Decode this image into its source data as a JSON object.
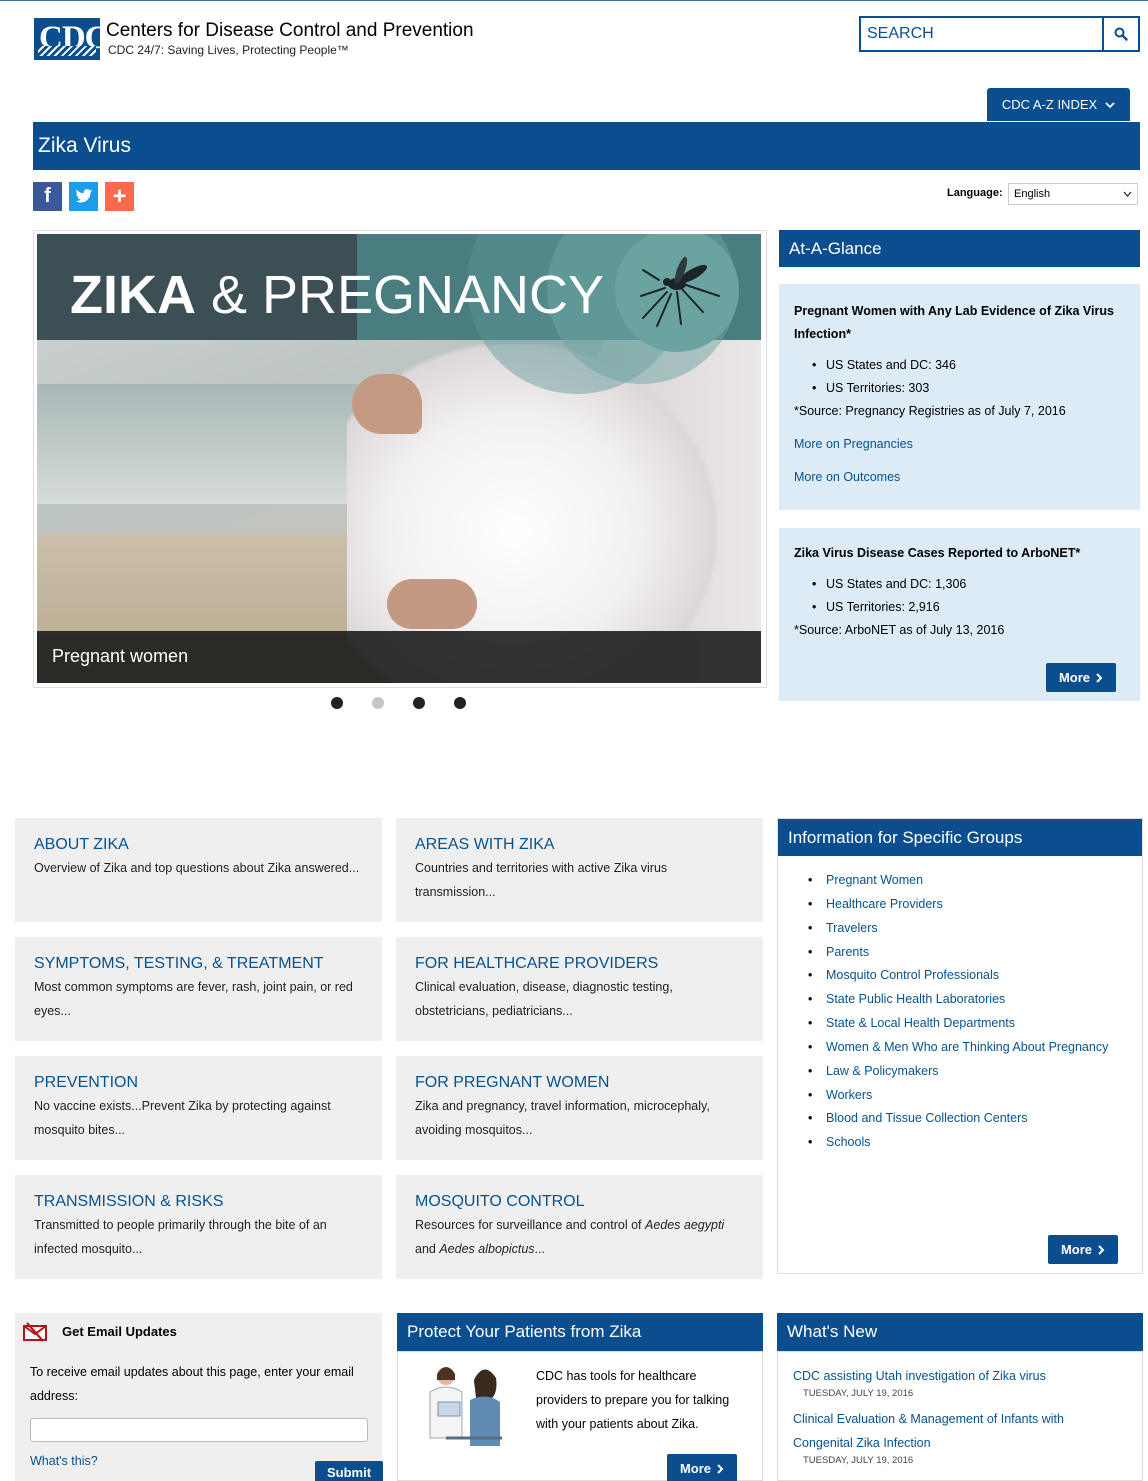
{
  "header": {
    "logo": "CDC",
    "org_title": "Centers for Disease Control and Prevention",
    "tagline": "CDC 24/7: Saving Lives, Protecting People™",
    "search_placeholder": "SEARCH",
    "az_index": "CDC A-Z INDEX"
  },
  "page": {
    "title": "Zika Virus",
    "language_label": "Language:",
    "language_value": "English"
  },
  "carousel": {
    "banner_bold": "ZIKA",
    "banner_rest": " & PREGNANCY",
    "caption": "Pregnant women",
    "slide_count": 4,
    "active_slide": 2
  },
  "glance": {
    "title": "At-A-Glance",
    "box1": {
      "heading": "Pregnant Women with Any Lab Evidence of Zika Virus Infection*",
      "items": [
        "US States and DC: 346",
        "US Territories: 303"
      ],
      "source": "*Source: Pregnancy Registries as of July 7, 2016",
      "link1": "More on Pregnancies",
      "link2": "More on Outcomes"
    },
    "box2": {
      "heading": "Zika Virus Disease Cases Reported to ArboNET*",
      "items": [
        "US States and DC: 1,306",
        "US Territories: 2,916"
      ],
      "source": "*Source: ArboNET as of July 13, 2016",
      "more": "More"
    }
  },
  "tiles": [
    {
      "title": "ABOUT ZIKA",
      "desc": "Overview of Zika and top questions about Zika answered..."
    },
    {
      "title": "AREAS WITH ZIKA",
      "desc": "Countries and territories with active Zika virus transmission..."
    },
    {
      "title": "SYMPTOMS, TESTING, & TREATMENT",
      "desc": "Most common symptoms are fever, rash, joint pain, or red eyes..."
    },
    {
      "title": "FOR HEALTHCARE PROVIDERS",
      "desc": "Clinical evaluation, disease, diagnostic testing, obstetricians, pediatricians..."
    },
    {
      "title": "PREVENTION",
      "desc": "No vaccine exists...Prevent Zika by protecting against mosquito bites..."
    },
    {
      "title": "FOR PREGNANT WOMEN",
      "desc": "Zika and pregnancy, travel information, microcephaly, avoiding mosquitos..."
    },
    {
      "title": "TRANSMISSION & RISKS",
      "desc": "Transmitted to people primarily through the bite of an infected mosquito..."
    },
    {
      "title": "MOSQUITO CONTROL",
      "desc_prefix": "Resources for surveillance and control of ",
      "desc_italic1": "Aedes aegypti",
      "desc_mid": " and ",
      "desc_italic2": "Aedes albopictus",
      "desc_suffix": "..."
    }
  ],
  "groups": {
    "title": "Information for Specific Groups",
    "items": [
      "Pregnant Women",
      "Healthcare Providers",
      "Travelers",
      "Parents",
      "Mosquito Control Professionals",
      "State Public Health Laboratories",
      "State & Local Health Departments",
      "Women & Men Who are Thinking About Pregnancy",
      "Law & Policymakers",
      "Workers",
      "Blood and Tissue Collection Centers",
      "Schools"
    ],
    "more": "More"
  },
  "email": {
    "title": "Get Email Updates",
    "text": "To receive email updates about this page, enter your email address:",
    "whats_this": "What's this?",
    "submit": "Submit"
  },
  "protect": {
    "title": "Protect Your Patients from Zika",
    "text": "CDC has tools for healthcare providers to prepare you for talking with your patients about Zika.",
    "more": "More"
  },
  "news": {
    "title": "What's New",
    "items": [
      {
        "title": "CDC assisting Utah investigation of Zika virus",
        "date": "TUESDAY, JULY 19, 2016"
      },
      {
        "title": "Clinical Evaluation & Management of Infants with Congenital Zika Infection",
        "date": "TUESDAY, JULY 19, 2016"
      }
    ]
  },
  "colors": {
    "brand_blue": "#0b4e8f",
    "panel_light_blue": "#ddebf6",
    "tile_gray": "#efefef",
    "link_blue": "#075290",
    "addthis_orange": "#f8694d",
    "twitter_blue": "#1c9de9",
    "facebook_blue": "#3b5998"
  }
}
